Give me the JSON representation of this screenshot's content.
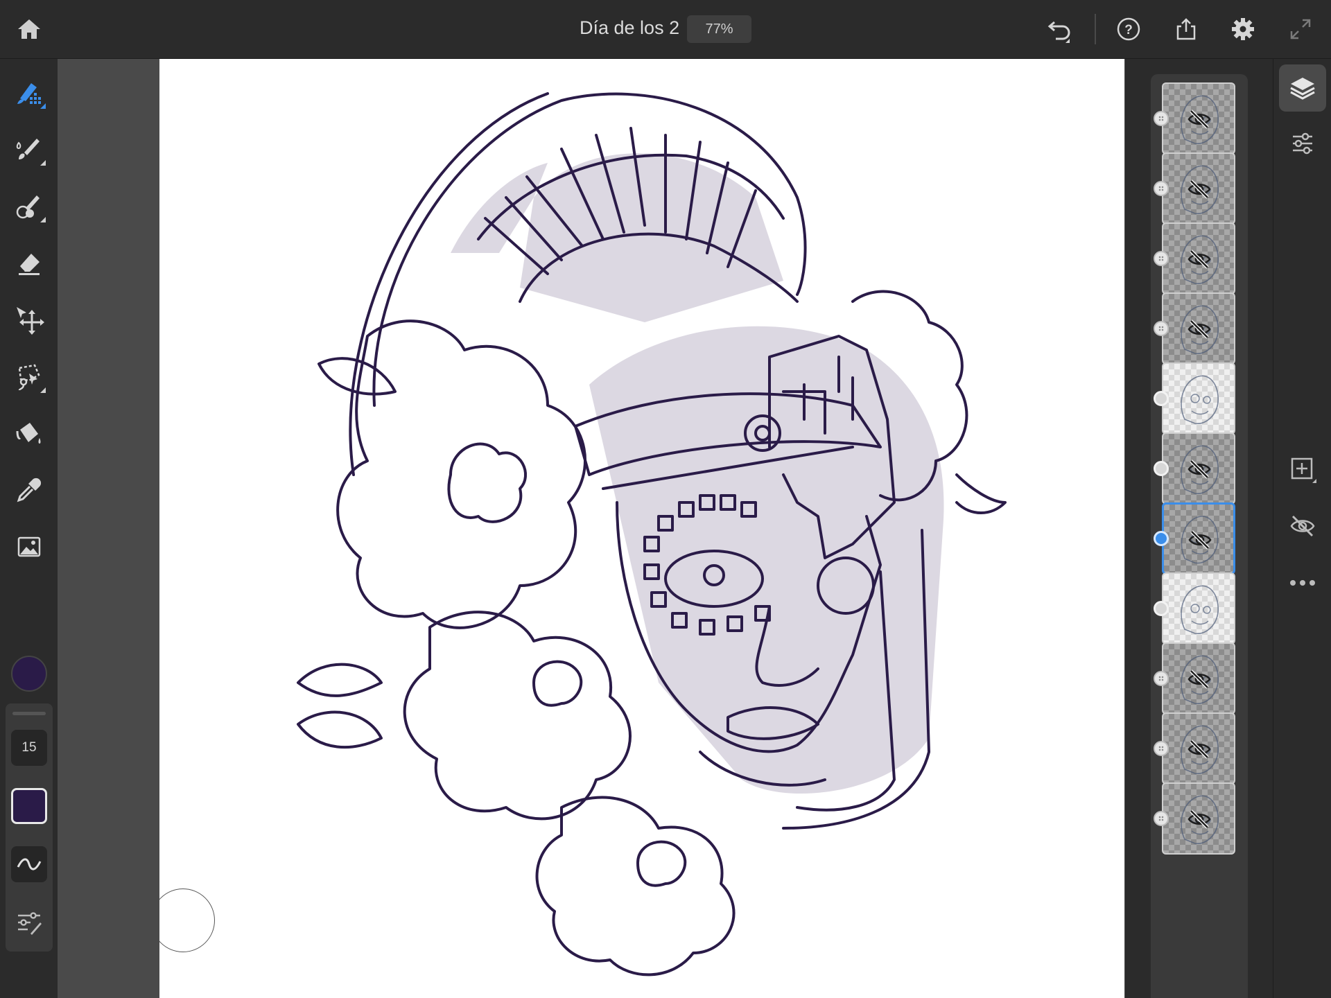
{
  "document": {
    "title": "Día de los 2",
    "zoom": "77%"
  },
  "top_bar": {
    "icons": [
      "home-icon",
      "undo-icon",
      "help-icon",
      "share-icon",
      "settings-icon",
      "fullscreen-icon"
    ]
  },
  "left_toolbar": {
    "tools": [
      "live-brush-icon",
      "paint-brush-icon",
      "blend-brush-icon",
      "eraser-icon",
      "move-transform-icon",
      "lasso-select-icon",
      "fill-bucket-icon",
      "eyedropper-icon",
      "image-place-icon"
    ],
    "active_tool": "live-brush-icon"
  },
  "brush_panel": {
    "size": "15",
    "color": "#2a1b48",
    "accent": "#3b8eea"
  },
  "layers": [
    {
      "state": "hidden",
      "dot": "grip",
      "selected": false
    },
    {
      "state": "hidden",
      "dot": "grip",
      "selected": false
    },
    {
      "state": "hidden",
      "dot": "grip",
      "selected": false
    },
    {
      "state": "hidden",
      "dot": "grip",
      "selected": false
    },
    {
      "state": "visible",
      "dot": "ring",
      "selected": false
    },
    {
      "state": "hidden",
      "dot": "ring",
      "selected": false
    },
    {
      "state": "hidden",
      "dot": "active",
      "selected": true
    },
    {
      "state": "visible",
      "dot": "ring",
      "selected": false
    },
    {
      "state": "hidden",
      "dot": "grip",
      "selected": false
    },
    {
      "state": "hidden",
      "dot": "grip",
      "selected": false
    },
    {
      "state": "hidden",
      "dot": "grip",
      "selected": false
    }
  ],
  "right_rail": {
    "icons": [
      "layers-icon",
      "layer-properties-icon",
      "add-layer-icon",
      "hide-layer-icon",
      "more-icon"
    ]
  }
}
